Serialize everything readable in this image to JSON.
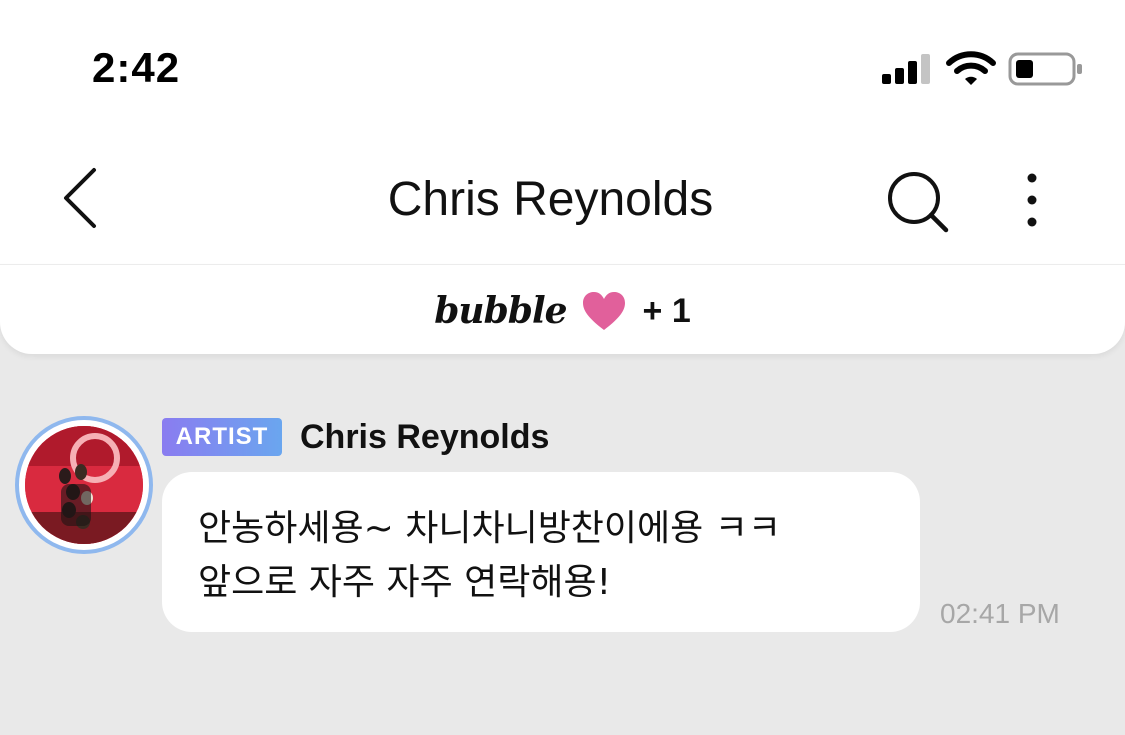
{
  "status_bar": {
    "time": "2:42",
    "icons": [
      "signal-icon",
      "wifi-icon",
      "battery-icon"
    ]
  },
  "nav": {
    "back_icon": "chevron-left-icon",
    "title": "Chris Reynolds",
    "search_icon": "search-icon",
    "more_icon": "more-vertical-icon"
  },
  "banner": {
    "brand": "bubble",
    "heart_color": "#e1609b",
    "bonus": "+ 1"
  },
  "message": {
    "badge": "ARTIST",
    "sender": "Chris Reynolds",
    "text": "안농하세용~ 차니차니방찬이에용 ㅋㅋ\n앞으로 자주 자주 연락해용!",
    "time": "02:41 PM"
  },
  "colors": {
    "background": "#e9e9e9",
    "bubble": "#ffffff",
    "badge_gradient_start": "#8a7cf0",
    "badge_gradient_end": "#6aa6ef",
    "avatar_ring": "#8fb8ee",
    "timestamp": "#a7a7a7"
  }
}
